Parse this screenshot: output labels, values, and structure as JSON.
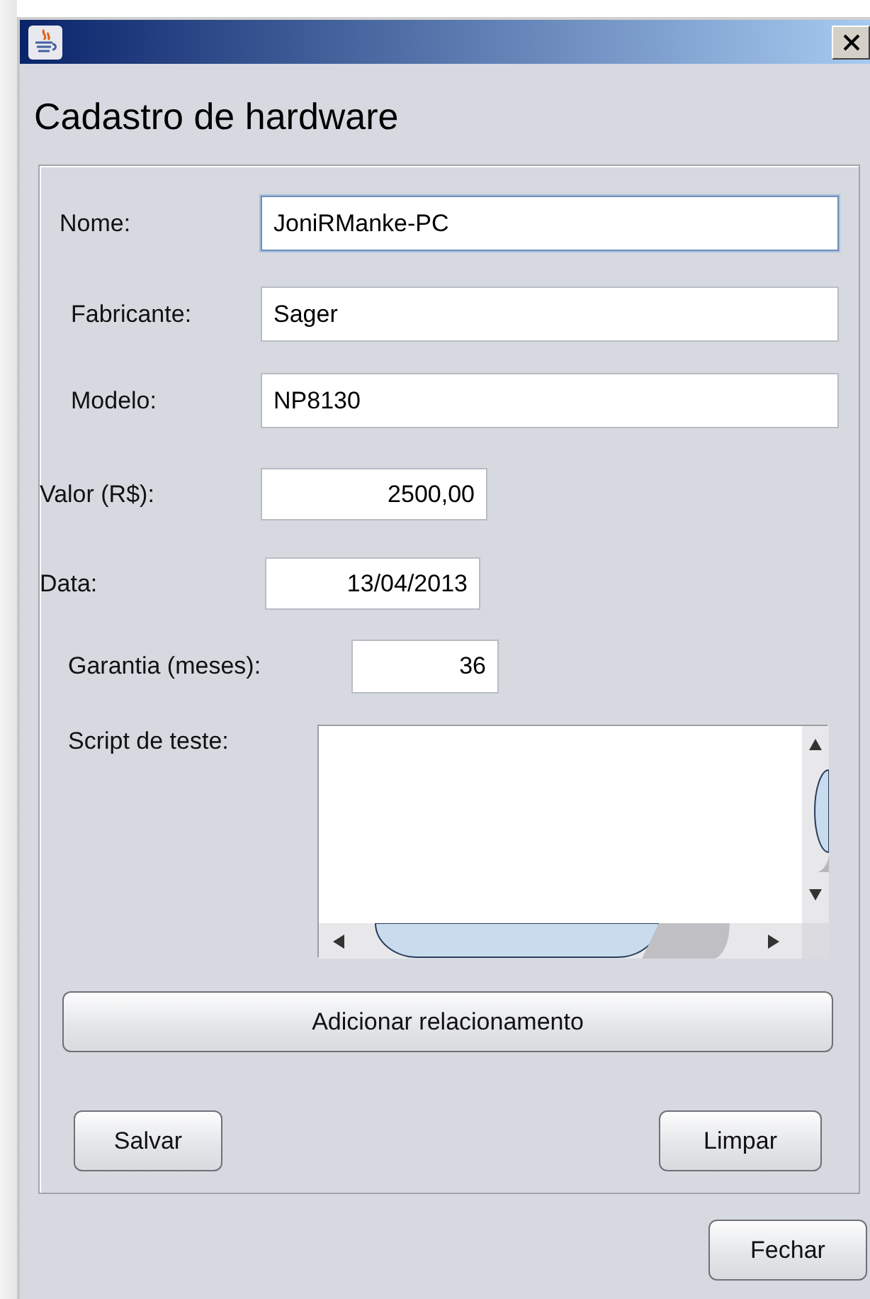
{
  "window": {
    "title": "Cadastro de hardware"
  },
  "fields": [
    {
      "label": "Nome:",
      "value": "JoniRManke-PC",
      "focused": true
    },
    {
      "label": "Fabricante:",
      "value": "Sager",
      "focused": false
    },
    {
      "label": "Modelo:",
      "value": "NP8130",
      "focused": false
    },
    {
      "label": "Valor (R$):",
      "value": "2500,00",
      "focused": false
    },
    {
      "label": "Data:",
      "value": "13/04/2013",
      "focused": false
    },
    {
      "label": "Garantia (meses):",
      "value": "36",
      "focused": false
    }
  ],
  "script_area": {
    "label": "Script de teste:"
  },
  "add_button": "Adicionar relacionamento",
  "panel_buttons": [
    "Salvar",
    "Limpar"
  ],
  "close_button": "Fechar"
}
